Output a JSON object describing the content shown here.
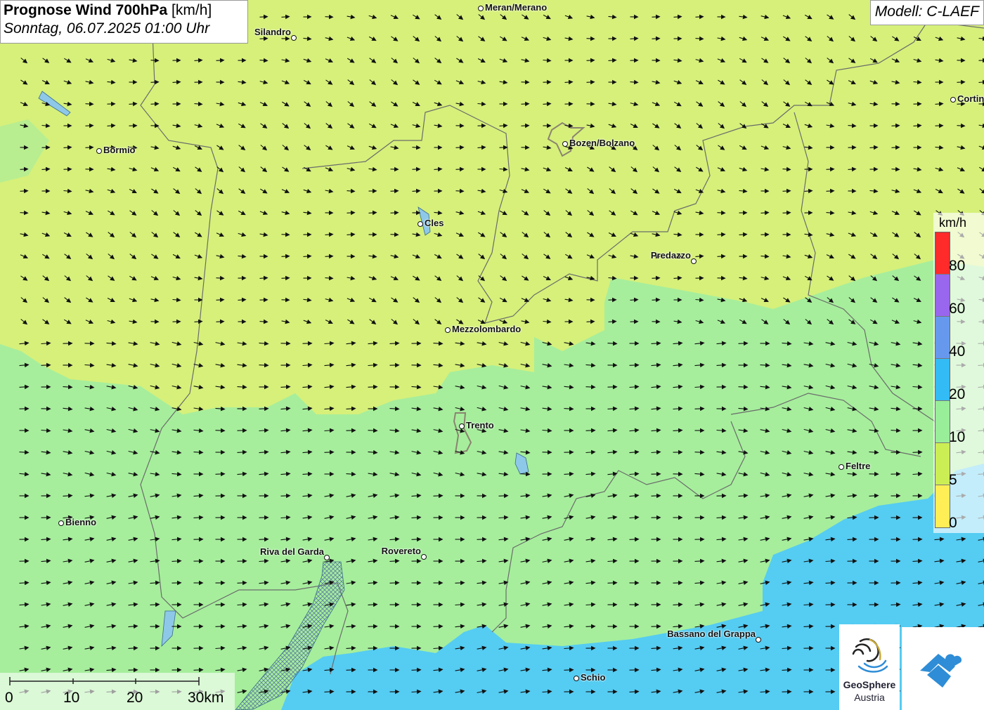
{
  "title": {
    "bold": "Prognose Wind 700hPa",
    "unit": " [km/h]",
    "datetime": "Sonntag, 06.07.2025 01:00 Uhr"
  },
  "model": "Modell: C-LAEF",
  "cities": [
    {
      "name": "Meran/Merano"
    },
    {
      "name": "Silandro"
    },
    {
      "name": "Bormio"
    },
    {
      "name": "Bozen/Bolzano"
    },
    {
      "name": "Cortina"
    },
    {
      "name": "Cles"
    },
    {
      "name": "Predazzo"
    },
    {
      "name": "Mezzolombardo"
    },
    {
      "name": "Trento"
    },
    {
      "name": "Feltre"
    },
    {
      "name": "Bienno"
    },
    {
      "name": "Riva del Garda"
    },
    {
      "name": "Rovereto"
    },
    {
      "name": "Bassano del Grappa"
    },
    {
      "name": "Schio"
    }
  ],
  "legend": {
    "unit": "km/h",
    "colors": [
      "#ff2a2a",
      "#9966ee",
      "#6699ee",
      "#33bbf5",
      "#99ee99",
      "#ccee55",
      "#ffee55"
    ],
    "values": [
      "80",
      "60",
      "40",
      "20",
      "10",
      "5",
      "0"
    ]
  },
  "scale": {
    "labels": [
      "0",
      "10",
      "20",
      "30km"
    ]
  },
  "logo": {
    "line1": "GeoSphere",
    "line2": "Austria"
  },
  "colors": {
    "calm": "#d6f07a",
    "light": "#a6ee9c",
    "moderate": "#55ccf2"
  }
}
